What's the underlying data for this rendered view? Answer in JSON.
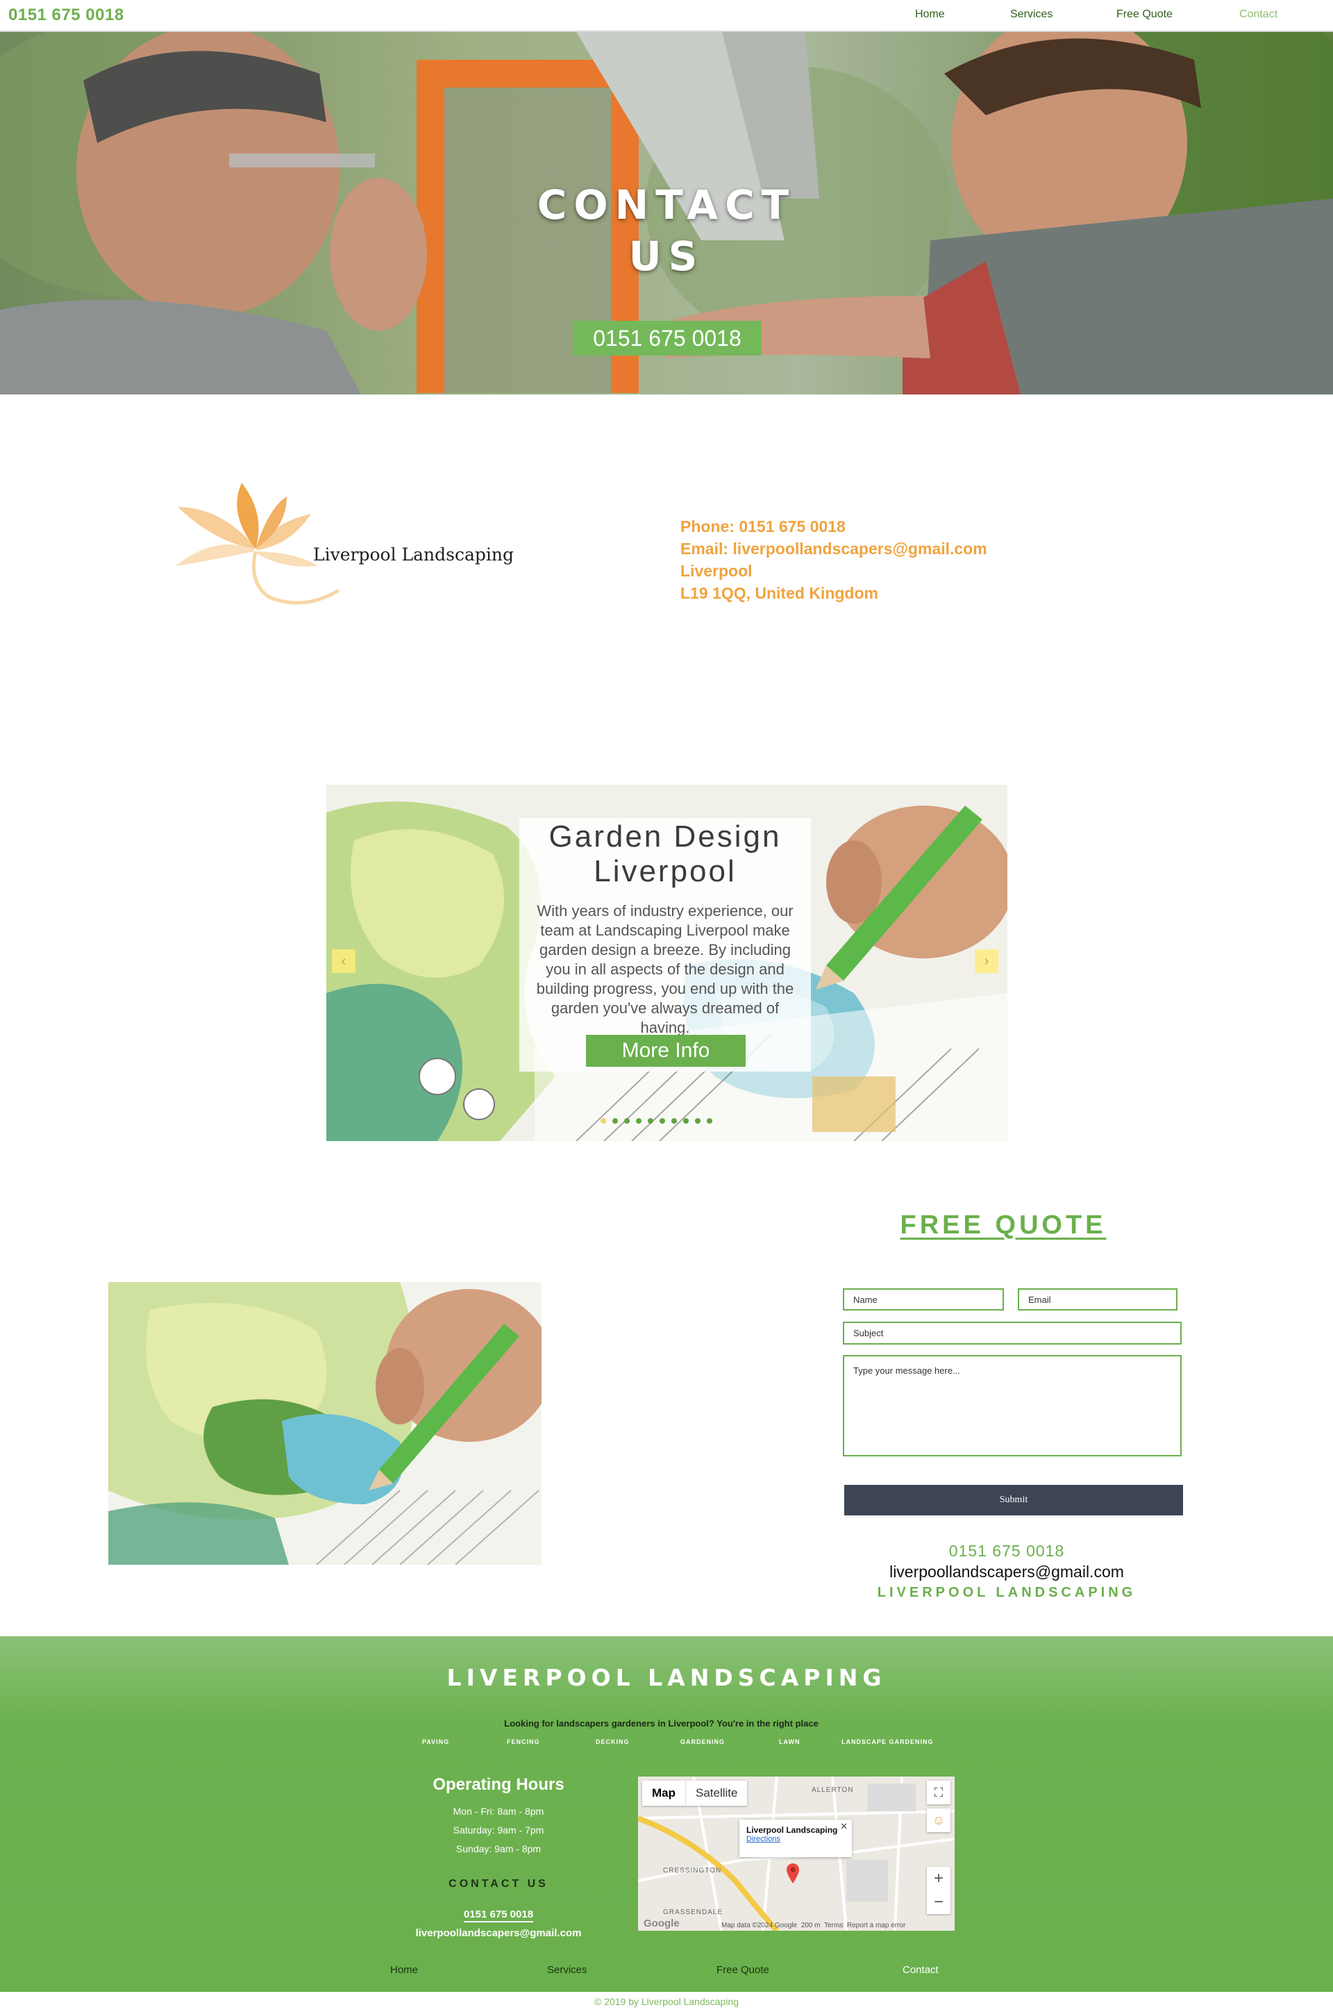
{
  "header": {
    "phone": "0151 675 0018",
    "nav": [
      "Home",
      "Services",
      "Free Quote",
      "Contact"
    ]
  },
  "hero": {
    "title": "CONTACT US",
    "phone_button": "0151 675 0018"
  },
  "brand": {
    "logo_text": "Liverpool Landscaping"
  },
  "contact_info": {
    "phone": "Phone: 0151 675 0018",
    "email": "Email: liverpoollandscapers@gmail.com",
    "city": "Liverpool",
    "postcode": "L19 1QQ, United Kingdom"
  },
  "slideshow": {
    "heading": "Garden Design Liverpool",
    "body": "With years of industry experience, our team at Landscaping Liverpool make garden design a breeze. By including you in all aspects of the design and building progress, you end up with the garden you've always dreamed of having.",
    "button": "More Info",
    "prev_arrow": "‹",
    "next_arrow": "›",
    "slide_count": 10,
    "active_slide": 1
  },
  "quote": {
    "title": "FREE QUOTE",
    "name_placeholder": "Name",
    "email_placeholder": "Email",
    "subject_placeholder": "Subject",
    "message_placeholder": "Type your message here...",
    "submit": "Submit",
    "phone": "0151 675 0018",
    "email": "liverpoollandscapers@gmail.com",
    "brand": "LIVERPOOL LANDSCAPING"
  },
  "footer": {
    "brand": "LIVERPOOL LANDSCAPING",
    "tagline": "Looking for landscapers gardeners in Liverpool? You're in the right place",
    "services": [
      "PAVING",
      "FENCING",
      "DECKING",
      "GARDENING",
      "LAWN",
      "LANDSCAPE GARDENING"
    ],
    "hours_title": "Operating Hours",
    "hours": [
      "Mon - Fri: 8am - 8pm",
      "Saturday: 9am - 7pm",
      "Sunday: 9am - 8pm"
    ],
    "contact_title": "CONTACT US",
    "phone": "0151 675 0018",
    "email": "liverpoollandscapers@gmail.com",
    "nav": [
      "Home",
      "Services",
      "Free Quote",
      "Contact"
    ],
    "copyright": "© 2019 by Liverpool Landscaping"
  },
  "map": {
    "tabs": [
      "Map",
      "Satellite"
    ],
    "place_name": "Liverpool Landscaping",
    "directions": "Directions",
    "labels": [
      "ALLERTON",
      "CRESSINGTON",
      "GRASSENDALE"
    ],
    "attribution": "Map data ©2024 Google",
    "scale": "200 m",
    "terms": "Terms",
    "report": "Report a map error",
    "google": "Google"
  },
  "colors": {
    "brand_green": "#6ab04c",
    "accent_orange": "#f0a33e",
    "button_dark": "#3d4454"
  }
}
